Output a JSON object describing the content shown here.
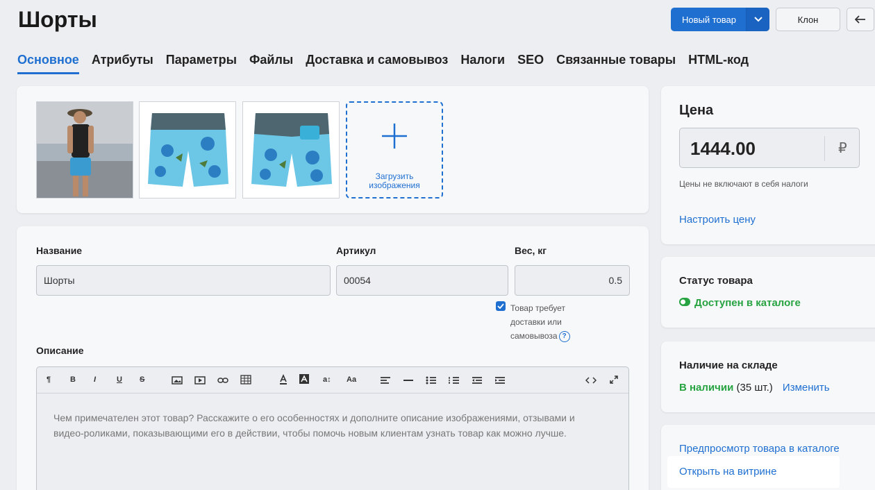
{
  "page": {
    "title": "Шорты"
  },
  "header": {
    "new_product_label": "Новый товар",
    "clone_label": "Клон"
  },
  "tabs": [
    {
      "label": "Основное"
    },
    {
      "label": "Атрибуты"
    },
    {
      "label": "Параметры"
    },
    {
      "label": "Файлы"
    },
    {
      "label": "Доставка и самовывоз"
    },
    {
      "label": "Налоги"
    },
    {
      "label": "SEO"
    },
    {
      "label": "Связанные товары"
    },
    {
      "label": "HTML-код"
    }
  ],
  "images": {
    "upload_label_1": "Загрузить",
    "upload_label_2": "изображения"
  },
  "form": {
    "name_label": "Название",
    "name_value": "Шорты",
    "sku_label": "Артикул",
    "sku_value": "00054",
    "weight_label": "Вес, кг",
    "weight_value": "0.5",
    "shipping_line1": "Товар требует",
    "shipping_line2": "доставки или",
    "shipping_line3": "самовывоза",
    "shipping_checked": true,
    "description_label": "Описание",
    "description_placeholder": "Чем примечателен этот товар? Расскажите о его особенностях и дополните описание изображениями, отзывами и видео-роликами, показывающими его в действии, чтобы помочь новым клиентам узнать товар как можно лучше."
  },
  "toolbar": {
    "items": [
      "¶",
      "B",
      "I",
      "U",
      "S",
      "a↕",
      "Aa"
    ]
  },
  "price": {
    "title": "Цена",
    "value": "1444.00",
    "currency": "₽",
    "note": "Цены не включают в себя налоги",
    "configure_link": "Настроить цену"
  },
  "status": {
    "title": "Статус товара",
    "value": "Доступен в каталоге"
  },
  "stock": {
    "title": "Наличие на складе",
    "state": "В наличии",
    "count": "(35 шт.)",
    "change_link": "Изменить"
  },
  "preview": {
    "preview_link": "Предпросмотр товара в каталоге",
    "open_link": "Открыть на витрине"
  },
  "colors": {
    "accent": "#1f6fd1",
    "success": "#27a341",
    "background": "#eceef1"
  }
}
